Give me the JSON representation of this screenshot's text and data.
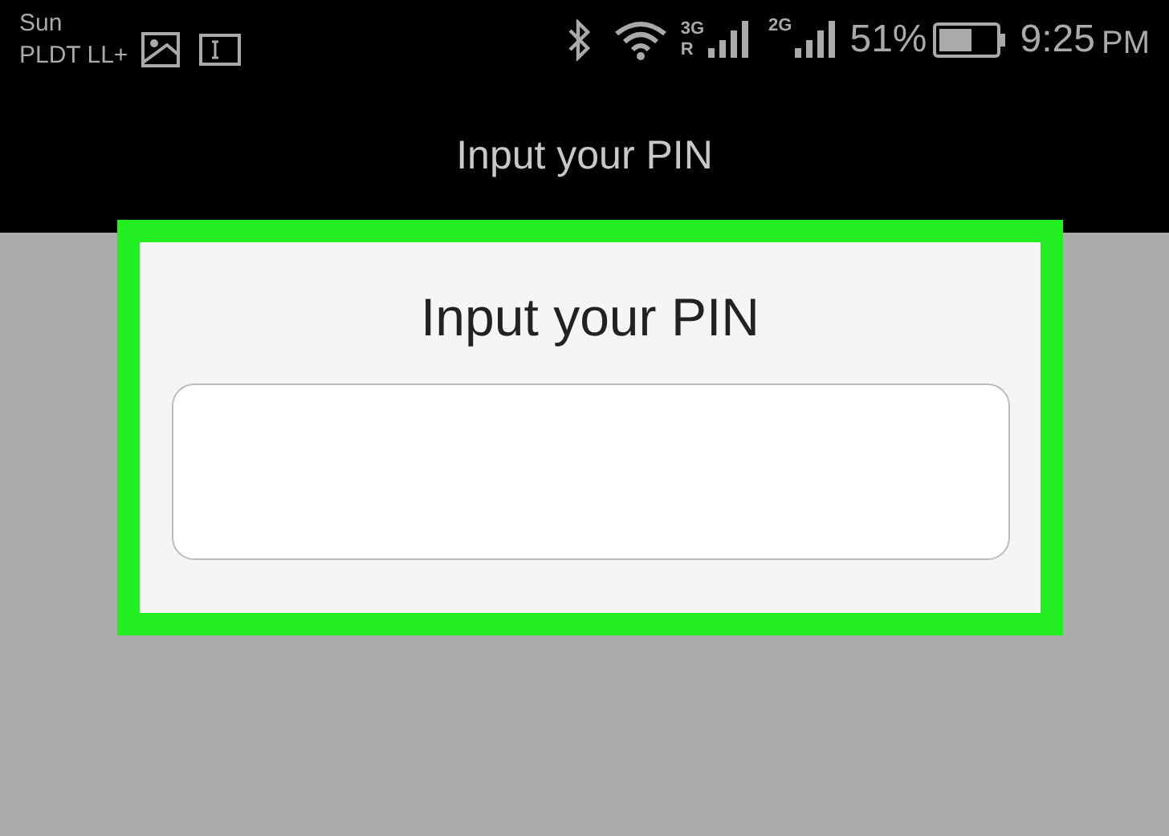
{
  "status_bar": {
    "carrier": "Sun",
    "network": "PLDT LL+",
    "sim1_type": "3G",
    "roaming": "R",
    "sim2_type": "2G",
    "battery": "51%",
    "time": "9:25",
    "period": "PM"
  },
  "app_bar": {
    "title": "Input your PIN"
  },
  "dialog": {
    "title": "Input your PIN",
    "highlighted": true
  }
}
